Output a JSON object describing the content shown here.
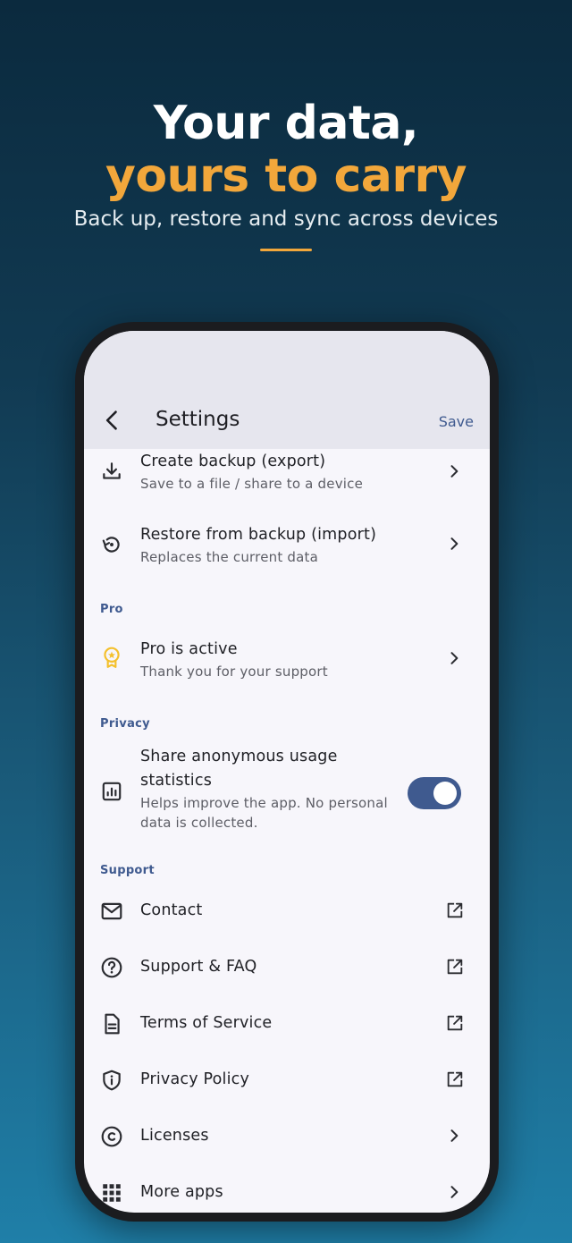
{
  "hero": {
    "title_line1": "Your data,",
    "title_line2": "yours to carry",
    "subtitle": "Back up, restore and sync across devices"
  },
  "colors": {
    "accent": "#f2a73b",
    "primary": "#3f5a8f",
    "pro_badge": "#f4c02c"
  },
  "appbar": {
    "title": "Settings",
    "save_label": "Save"
  },
  "backup": {
    "create": {
      "title": "Create backup (export)",
      "subtitle": "Save to a file / share to a device",
      "icon": "download-icon"
    },
    "restore": {
      "title": "Restore from backup (import)",
      "subtitle": "Replaces the current data",
      "icon": "restore-icon"
    }
  },
  "sections": {
    "pro": "Pro",
    "privacy": "Privacy",
    "support": "Support"
  },
  "pro": {
    "title": "Pro is active",
    "subtitle": "Thank you for your support",
    "icon": "award-icon"
  },
  "privacy": {
    "title_line1": "Share anonymous usage",
    "title_line2": "statistics",
    "subtitle_line1": "Helps improve the app. No personal",
    "subtitle_line2": "data is collected.",
    "toggle_on": true,
    "icon": "chart-icon"
  },
  "support_items": [
    {
      "label": "Contact",
      "icon": "mail-icon",
      "action": "external"
    },
    {
      "label": "Support & FAQ",
      "icon": "help-icon",
      "action": "external"
    },
    {
      "label": "Terms of Service",
      "icon": "document-icon",
      "action": "external"
    },
    {
      "label": "Privacy Policy",
      "icon": "shield-info-icon",
      "action": "external"
    },
    {
      "label": "Licenses",
      "icon": "copyright-icon",
      "action": "chevron"
    },
    {
      "label": "More apps",
      "icon": "apps-grid-icon",
      "action": "chevron"
    }
  ]
}
